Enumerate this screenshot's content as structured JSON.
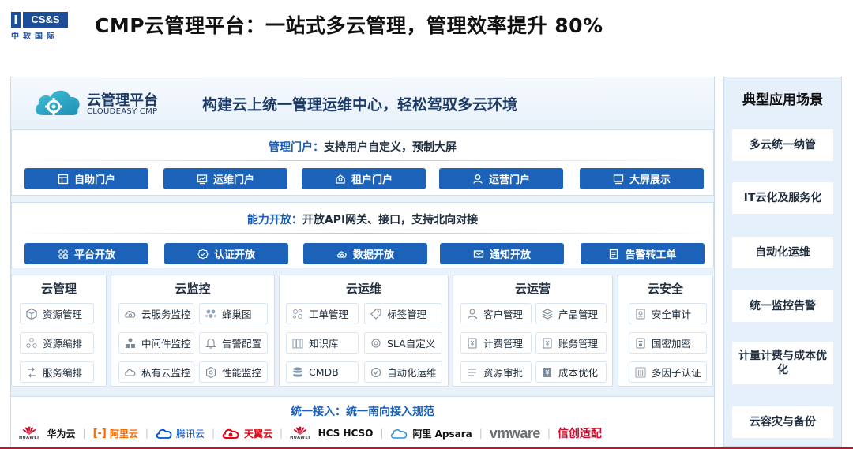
{
  "logo": {
    "mark": "I",
    "box": "CS&S",
    "sub": "中软国际"
  },
  "title": "CMP云管理平台：一站式多云管理，管理效率提升 80%",
  "header": {
    "name": "云管理平台",
    "sub": "CLOUDEASY CMP",
    "slogan": "构建云上统一管理运维中心，轻松驾驭多云环境"
  },
  "portal": {
    "title_hl": "管理门户：",
    "title_rest": "支持用户自定义，预制大屏",
    "buttons": [
      {
        "label": "自助门户",
        "icon": "layout-icon"
      },
      {
        "label": "运维门户",
        "icon": "monitor-chart-icon"
      },
      {
        "label": "租户门户",
        "icon": "tenant-icon"
      },
      {
        "label": "运营门户",
        "icon": "user-icon"
      },
      {
        "label": "大屏展示",
        "icon": "screen-icon"
      }
    ]
  },
  "capability": {
    "title_hl": "能力开放：",
    "title_rest": "开放API网关、接口，支持北向对接",
    "buttons": [
      {
        "label": "平台开放",
        "icon": "grid-icon"
      },
      {
        "label": "认证开放",
        "icon": "badge-check-icon"
      },
      {
        "label": "数据开放",
        "icon": "cloud-data-icon"
      },
      {
        "label": "通知开放",
        "icon": "mail-icon"
      },
      {
        "label": "告警转工单",
        "icon": "document-icon"
      }
    ]
  },
  "categories": [
    {
      "title": "云管理",
      "items": [
        "资源管理",
        "资源编排",
        "服务编排"
      ]
    },
    {
      "title": "云监控",
      "items": [
        "云服务监控",
        "蜂巢图",
        "中间件监控",
        "告警配置",
        "私有云监控",
        "性能监控"
      ]
    },
    {
      "title": "云运维",
      "items": [
        "工单管理",
        "标签管理",
        "知识库",
        "SLA自定义",
        "CMDB",
        "自动化运维"
      ]
    },
    {
      "title": "云运营",
      "items": [
        "客户管理",
        "产品管理",
        "计费管理",
        "账务管理",
        "资源审批",
        "成本优化"
      ]
    },
    {
      "title": "云安全",
      "items": [
        "安全审计",
        "国密加密",
        "多因子认证"
      ]
    }
  ],
  "access": {
    "title_hl": "统一接入：",
    "title_rest": "统一南向接入规范",
    "vendors": [
      "华为云",
      "阿里云",
      "腾讯云",
      "天翼云",
      "HCS HCSO",
      "阿里 Apsara",
      "vmware",
      "信创适配"
    ],
    "huawei_sub": "HUAWEI",
    "separator": "|"
  },
  "scenarios": {
    "title": "典型应用场景",
    "items": [
      "多云统一纳管",
      "IT云化及服务化",
      "自动化运维",
      "统一监控告警",
      "计量计费与成本优化",
      "云容灾与备份"
    ]
  },
  "colors": {
    "primary": "#1b62b8",
    "title_blue": "#1a5fb4",
    "huawei_red": "#cf0a2c",
    "aliyun_orange": "#ff6a00",
    "tencent_blue": "#0052d9",
    "tianyi_red": "#e60012",
    "accent_red": "#c8102e"
  }
}
